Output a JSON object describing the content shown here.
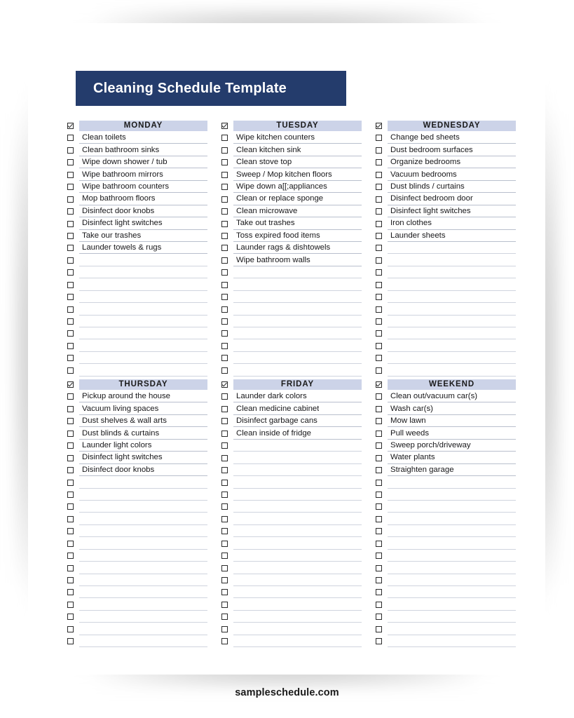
{
  "document": {
    "title": "Cleaning Schedule Template",
    "footer": "sampleschedule.com"
  },
  "colors": {
    "banner": "#243c6c",
    "banner_text": "#ffffff",
    "header_band": "#ccd3e8",
    "page": "#ffffff",
    "rule": "#b9bfcd"
  },
  "icons": {
    "header_checkbox": "checked-checkbox",
    "item_checkbox": "empty-checkbox"
  },
  "rows_per_column": {
    "block_1": 20,
    "block_2": 21
  },
  "blocks": [
    {
      "columns": [
        {
          "header": "MONDAY",
          "items": [
            "Clean toilets",
            "Clean bathroom sinks",
            "Wipe down shower / tub",
            "Wipe bathroom mirrors",
            "Wipe bathroom counters",
            "Mop bathroom floors",
            "Disinfect door knobs",
            "Disinfect light switches",
            "Take our trashes",
            "Launder towels & rugs"
          ]
        },
        {
          "header": "TUESDAY",
          "items": [
            "Wipe kitchen counters",
            "Clean kitchen sink",
            "Clean stove top",
            "Sweep / Mop kitchen floors",
            "Wipe down a[[;appliances",
            "Clean or replace sponge",
            "Clean microwave",
            "Take out trashes",
            "Toss expired food items",
            "Launder rags & dishtowels",
            "Wipe bathroom walls"
          ]
        },
        {
          "header": "WEDNESDAY",
          "items": [
            "Change bed sheets",
            "Dust bedroom surfaces",
            "Organize bedrooms",
            "Vacuum bedrooms",
            "Dust blinds / curtains",
            "Disinfect bedroom door",
            "Disinfect light switches",
            "Iron clothes",
            "Launder sheets"
          ]
        }
      ]
    },
    {
      "columns": [
        {
          "header": "THURSDAY",
          "items": [
            "Pickup around the house",
            "Vacuum living spaces",
            "Dust shelves & wall arts",
            "Dust blinds & curtains",
            "Launder light colors",
            "Disinfect light switches",
            "Disinfect door knobs"
          ]
        },
        {
          "header": "FRIDAY",
          "items": [
            "Launder dark colors",
            "Clean medicine cabinet",
            "Disinfect garbage cans",
            "Clean inside of fridge"
          ]
        },
        {
          "header": "WEEKEND",
          "items": [
            "Clean out/vacuum car(s)",
            "Wash car(s)",
            "Mow lawn",
            "Pull weeds",
            "Sweep porch/driveway",
            "Water plants",
            "Straighten garage"
          ]
        }
      ]
    }
  ]
}
